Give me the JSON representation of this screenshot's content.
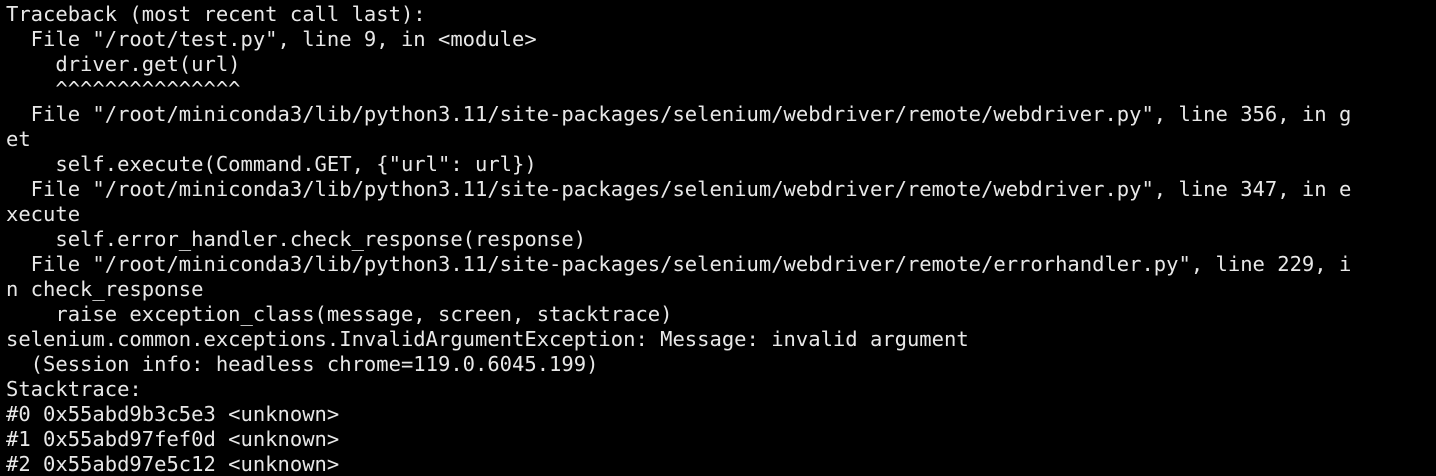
{
  "terminal": {
    "background": "#000000",
    "foreground": "#e8e8e8",
    "lines": [
      "Traceback (most recent call last):",
      "  File \"/root/test.py\", line 9, in <module>",
      "    driver.get(url)",
      "    ^^^^^^^^^^^^^^^",
      "  File \"/root/miniconda3/lib/python3.11/site-packages/selenium/webdriver/remote/webdriver.py\", line 356, in g",
      "et",
      "    self.execute(Command.GET, {\"url\": url})",
      "  File \"/root/miniconda3/lib/python3.11/site-packages/selenium/webdriver/remote/webdriver.py\", line 347, in e",
      "xecute",
      "    self.error_handler.check_response(response)",
      "  File \"/root/miniconda3/lib/python3.11/site-packages/selenium/webdriver/remote/errorhandler.py\", line 229, i",
      "n check_response",
      "    raise exception_class(message, screen, stacktrace)",
      "selenium.common.exceptions.InvalidArgumentException: Message: invalid argument",
      "  (Session info: headless chrome=119.0.6045.199)",
      "Stacktrace:",
      "#0 0x55abd9b3c5e3 <unknown>",
      "#1 0x55abd97fef0d <unknown>",
      "#2 0x55abd97e5c12 <unknown>"
    ]
  }
}
